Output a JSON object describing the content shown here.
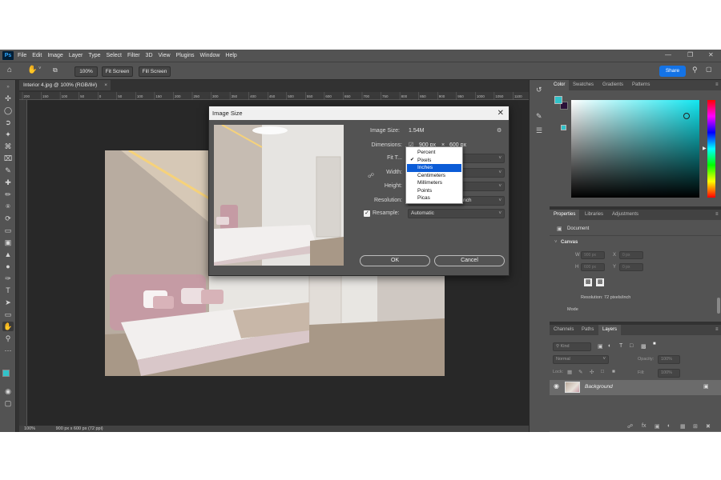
{
  "menu": {
    "logo": "Ps",
    "items": [
      "File",
      "Edit",
      "Image",
      "Layer",
      "Type",
      "Select",
      "Filter",
      "3D",
      "View",
      "Plugins",
      "Window",
      "Help"
    ]
  },
  "options_bar": {
    "zoom": "100%",
    "fit_screen": "Fit Screen",
    "fill_screen": "Fill Screen",
    "share": "Share"
  },
  "document": {
    "tab_title": "Interior 4.jpg @ 100% (RGB/8#)",
    "tab_close": "×",
    "status_zoom": "100%",
    "status_info": "900 px x 600 px (72 ppi)"
  },
  "ruler_ticks": [
    "200",
    "150",
    "100",
    "50",
    "0",
    "50",
    "100",
    "150",
    "200",
    "250",
    "300",
    "350",
    "400",
    "450",
    "500",
    "550",
    "600",
    "650",
    "700",
    "750",
    "800",
    "850",
    "900",
    "950",
    "1000",
    "1050",
    "1100"
  ],
  "dialog": {
    "title": "Image Size",
    "close": "✕",
    "image_size_label": "Image Size:",
    "image_size_value": "1.54M",
    "dimensions_label": "Dimensions:",
    "dimensions_width": "900 px",
    "dimensions_x": "×",
    "dimensions_height": "600 px",
    "fit_to_label": "Fit T...",
    "width_label": "Width:",
    "height_label": "Height:",
    "resolution_label": "Resolution:",
    "resolution_unit_partial": "nch",
    "resample_label": "Resample:",
    "resample_value": "Automatic",
    "resample_checked": true,
    "ok": "OK",
    "cancel": "Cancel"
  },
  "unit_dropdown": {
    "items": [
      "Percent",
      "Pixels",
      "Inches",
      "Centimeters",
      "Millimeters",
      "Points",
      "Picas"
    ],
    "checked_index": 1,
    "highlighted_index": 2
  },
  "color_panel": {
    "tabs": [
      "Color",
      "Swatches",
      "Gradients",
      "Patterns"
    ],
    "foreground": "#31c3c9",
    "background": "#2a1038"
  },
  "properties_panel": {
    "tabs": [
      "Properties",
      "Libraries",
      "Adjustments"
    ],
    "document_label": "Document",
    "canvas_label": "Canvas",
    "w_label": "W",
    "h_label": "H",
    "x_label": "X",
    "y_label": "Y",
    "w_value": "900 px",
    "h_value": "600 px",
    "x_value": "0 px",
    "y_value": "0 px",
    "resolution": "Resolution: 72 pixels/inch",
    "mode_label": "Mode"
  },
  "layers_panel": {
    "tabs": [
      "Channels",
      "Paths",
      "Layers"
    ],
    "filter_kind": "Kind",
    "blend_mode": "Normal",
    "opacity_label": "Opacity:",
    "opacity_value": "100%",
    "lock_label": "Lock:",
    "fill_label": "Fill:",
    "fill_value": "100%",
    "layer_name": "Background"
  },
  "colors": {
    "accent": "#1473e6",
    "dropdown_highlight": "#0b5cd7"
  }
}
